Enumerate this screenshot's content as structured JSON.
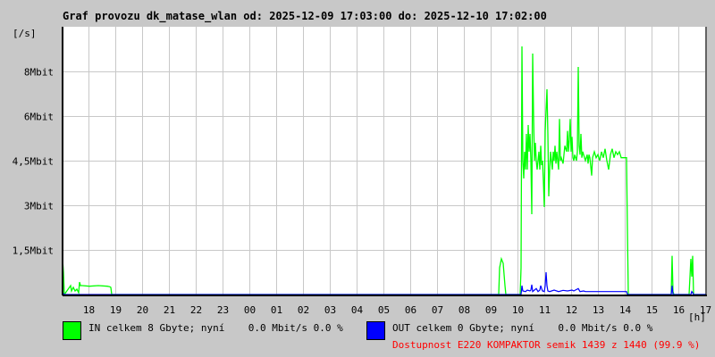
{
  "title": "Graf provozu dk_matase_wlan od: 2025-12-09 17:03:00 do: 2025-12-10 17:02:00",
  "legend": {
    "in": "IN celkem 8 Gbyte; nyní    0.0 Mbit/s 0.0 %",
    "out": "OUT celkem 0 Gbyte; nyní    0.0 Mbit/s 0.0 %",
    "availability": "Dostupnost E220 KOMPAKTOR semik 1439 z 1440 (99.9 %)"
  },
  "chart_data": {
    "type": "line",
    "title": "Graf provozu dk_matase_wlan od: 2025-12-09 17:03:00 do: 2025-12-10 17:02:00",
    "ylabel": "[/s]",
    "xlabel": "[h]",
    "x_unit": "minutes since 2025-12-09 17:03",
    "xlim": [
      0,
      1440
    ],
    "ylim": [
      0,
      9
    ],
    "grid": true,
    "yticks": [
      {
        "v": 1.5,
        "label": "1,5Mbit"
      },
      {
        "v": 3,
        "label": "3Mbit"
      },
      {
        "v": 4.5,
        "label": "4,5Mbit"
      },
      {
        "v": 6,
        "label": "6Mbit"
      },
      {
        "v": 7.5,
        "label": "8Mbit"
      }
    ],
    "xticks": [
      "18",
      "19",
      "20",
      "21",
      "22",
      "23",
      "00",
      "01",
      "02",
      "03",
      "04",
      "05",
      "06",
      "07",
      "08",
      "09",
      "10",
      "11",
      "12",
      "13",
      "14",
      "15",
      "16",
      "17"
    ],
    "colors": {
      "in": "#00ff00",
      "out": "#0000ff",
      "grid": "#c8c8c8"
    },
    "series": [
      {
        "name": "IN",
        "color": "#00ff00",
        "points": [
          [
            0,
            1.2
          ],
          [
            2,
            0.75
          ],
          [
            4,
            0
          ],
          [
            18,
            0.3
          ],
          [
            20,
            0.12
          ],
          [
            24,
            0.24
          ],
          [
            28,
            0.12
          ],
          [
            32,
            0.18
          ],
          [
            36,
            0.06
          ],
          [
            38,
            0.42
          ],
          [
            40,
            0.3
          ],
          [
            44,
            0.3
          ],
          [
            60,
            0.28
          ],
          [
            80,
            0.3
          ],
          [
            100,
            0.28
          ],
          [
            106,
            0.26
          ],
          [
            108,
            0.24
          ],
          [
            110,
            0
          ],
          [
            976,
            0
          ],
          [
            978,
            0.9
          ],
          [
            982,
            1.2
          ],
          [
            986,
            1.05
          ],
          [
            990,
            0.3
          ],
          [
            992,
            0
          ],
          [
            1024,
            0
          ],
          [
            1026,
            0.9
          ],
          [
            1028,
            8.34
          ],
          [
            1030,
            4.5
          ],
          [
            1032,
            3.9
          ],
          [
            1034,
            4.8
          ],
          [
            1036,
            4.2
          ],
          [
            1038,
            5.4
          ],
          [
            1040,
            4.2
          ],
          [
            1042,
            5.7
          ],
          [
            1044,
            4.8
          ],
          [
            1046,
            5.4
          ],
          [
            1048,
            4.5
          ],
          [
            1050,
            2.7
          ],
          [
            1052,
            8.1
          ],
          [
            1054,
            6.0
          ],
          [
            1056,
            4.5
          ],
          [
            1058,
            5.1
          ],
          [
            1060,
            4.5
          ],
          [
            1062,
            4.2
          ],
          [
            1064,
            4.5
          ],
          [
            1066,
            4.8
          ],
          [
            1068,
            4.2
          ],
          [
            1070,
            5.0
          ],
          [
            1072,
            4.35
          ],
          [
            1074,
            4.5
          ],
          [
            1076,
            3.8
          ],
          [
            1078,
            2.94
          ],
          [
            1080,
            5.5
          ],
          [
            1082,
            6.2
          ],
          [
            1084,
            6.9
          ],
          [
            1086,
            5.4
          ],
          [
            1088,
            3.3
          ],
          [
            1090,
            4.2
          ],
          [
            1092,
            4.8
          ],
          [
            1094,
            4.5
          ],
          [
            1096,
            4.2
          ],
          [
            1098,
            4.8
          ],
          [
            1100,
            4.5
          ],
          [
            1102,
            5.0
          ],
          [
            1104,
            4.4
          ],
          [
            1106,
            4.8
          ],
          [
            1108,
            4.5
          ],
          [
            1110,
            4.2
          ],
          [
            1112,
            5.9
          ],
          [
            1114,
            4.5
          ],
          [
            1116,
            4.6
          ],
          [
            1120,
            4.4
          ],
          [
            1124,
            5.0
          ],
          [
            1128,
            4.8
          ],
          [
            1130,
            5.5
          ],
          [
            1132,
            4.8
          ],
          [
            1134,
            5.2
          ],
          [
            1136,
            5.9
          ],
          [
            1138,
            4.8
          ],
          [
            1140,
            5.3
          ],
          [
            1142,
            4.6
          ],
          [
            1144,
            4.5
          ],
          [
            1146,
            4.7
          ],
          [
            1148,
            4.6
          ],
          [
            1150,
            4.5
          ],
          [
            1152,
            4.8
          ],
          [
            1154,
            7.65
          ],
          [
            1156,
            5.0
          ],
          [
            1158,
            4.7
          ],
          [
            1160,
            5.4
          ],
          [
            1162,
            4.6
          ],
          [
            1164,
            4.8
          ],
          [
            1166,
            4.7
          ],
          [
            1170,
            4.5
          ],
          [
            1174,
            4.7
          ],
          [
            1176,
            4.4
          ],
          [
            1178,
            4.7
          ],
          [
            1180,
            4.6
          ],
          [
            1182,
            4.3
          ],
          [
            1184,
            4.0
          ],
          [
            1186,
            4.6
          ],
          [
            1190,
            4.8
          ],
          [
            1194,
            4.6
          ],
          [
            1198,
            4.7
          ],
          [
            1202,
            4.5
          ],
          [
            1206,
            4.8
          ],
          [
            1210,
            4.6
          ],
          [
            1214,
            4.9
          ],
          [
            1218,
            4.5
          ],
          [
            1222,
            4.2
          ],
          [
            1226,
            4.7
          ],
          [
            1230,
            4.9
          ],
          [
            1234,
            4.6
          ],
          [
            1238,
            4.8
          ],
          [
            1242,
            4.7
          ],
          [
            1246,
            4.8
          ],
          [
            1250,
            4.6
          ],
          [
            1262,
            4.6
          ],
          [
            1264,
            2.2
          ],
          [
            1266,
            0
          ],
          [
            1362,
            0
          ],
          [
            1364,
            1.3
          ],
          [
            1366,
            0.1
          ],
          [
            1368,
            0
          ],
          [
            1402,
            0
          ],
          [
            1404,
            0.6
          ],
          [
            1406,
            1.2
          ],
          [
            1408,
            0.6
          ],
          [
            1410,
            1.3
          ],
          [
            1412,
            0
          ],
          [
            1440,
            0
          ]
        ]
      },
      {
        "name": "OUT",
        "color": "#0000ff",
        "points": [
          [
            0,
            0.06
          ],
          [
            4,
            0
          ],
          [
            1026,
            0
          ],
          [
            1028,
            0.3
          ],
          [
            1030,
            0.12
          ],
          [
            1036,
            0.1
          ],
          [
            1040,
            0.15
          ],
          [
            1046,
            0.12
          ],
          [
            1048,
            0.15
          ],
          [
            1050,
            0.33
          ],
          [
            1052,
            0.1
          ],
          [
            1056,
            0.15
          ],
          [
            1060,
            0.2
          ],
          [
            1064,
            0.1
          ],
          [
            1068,
            0.15
          ],
          [
            1070,
            0.3
          ],
          [
            1072,
            0.2
          ],
          [
            1074,
            0.12
          ],
          [
            1078,
            0.1
          ],
          [
            1080,
            0.3
          ],
          [
            1082,
            0.75
          ],
          [
            1084,
            0.3
          ],
          [
            1086,
            0.12
          ],
          [
            1090,
            0.1
          ],
          [
            1100,
            0.15
          ],
          [
            1110,
            0.1
          ],
          [
            1120,
            0.14
          ],
          [
            1130,
            0.12
          ],
          [
            1140,
            0.15
          ],
          [
            1144,
            0.12
          ],
          [
            1154,
            0.2
          ],
          [
            1158,
            0.1
          ],
          [
            1166,
            0.12
          ],
          [
            1170,
            0.1
          ],
          [
            1180,
            0.1
          ],
          [
            1230,
            0.1
          ],
          [
            1262,
            0.1
          ],
          [
            1264,
            0
          ],
          [
            1362,
            0
          ],
          [
            1364,
            0.3
          ],
          [
            1366,
            0
          ],
          [
            1406,
            0
          ],
          [
            1408,
            0.1
          ],
          [
            1410,
            0.06
          ],
          [
            1412,
            0
          ],
          [
            1440,
            0
          ]
        ]
      }
    ]
  }
}
